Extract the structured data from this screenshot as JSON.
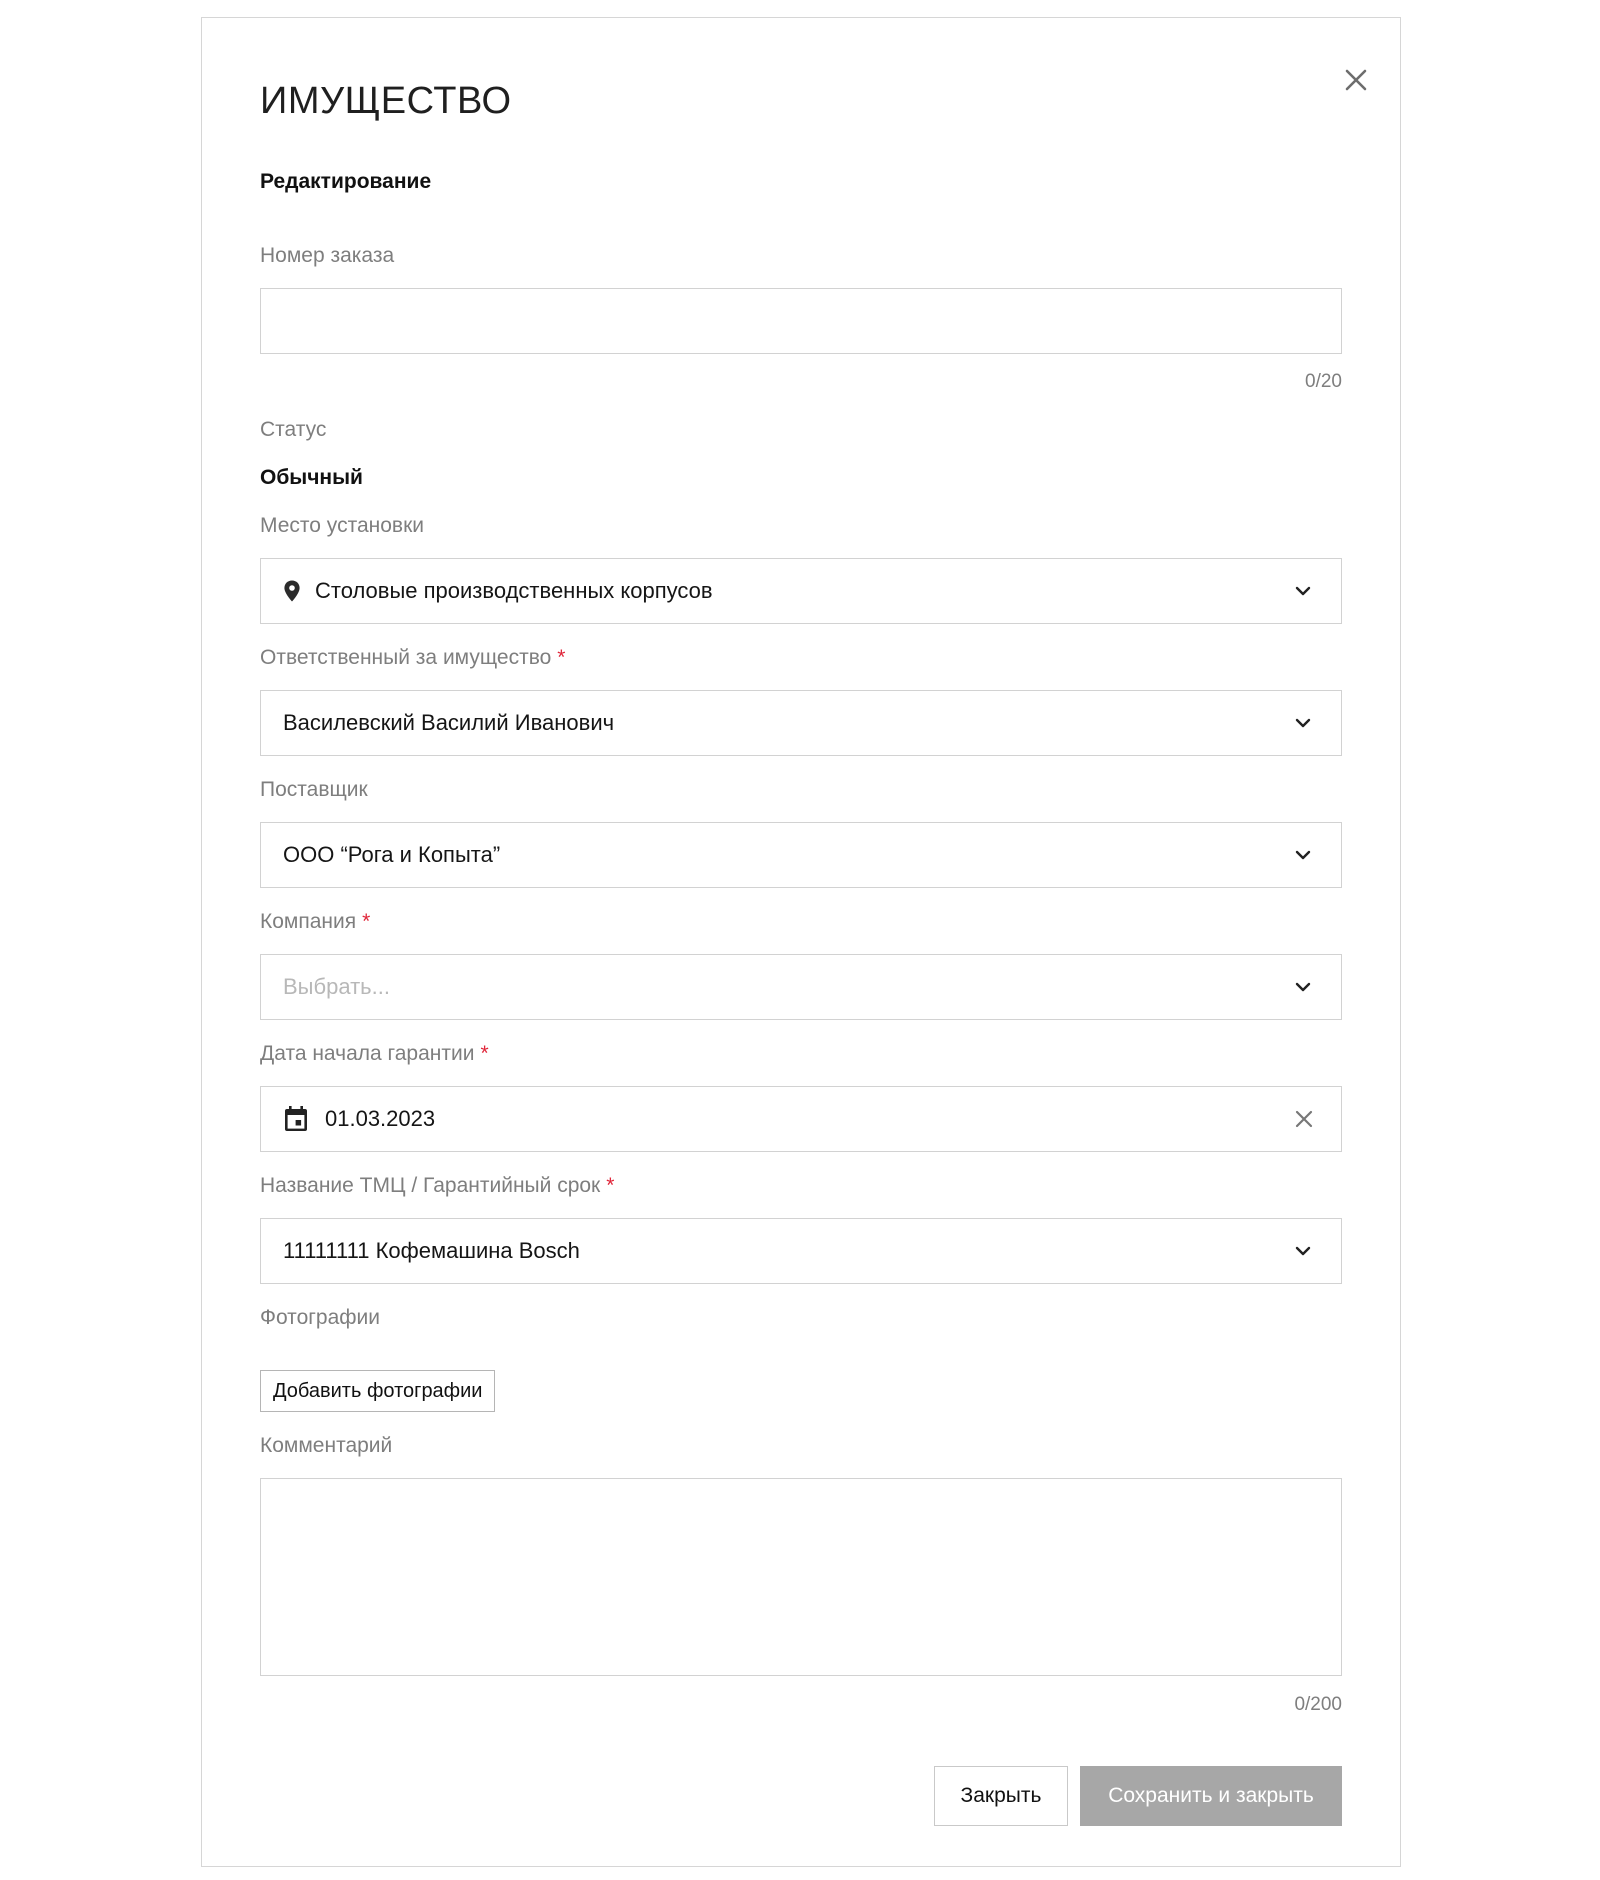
{
  "modal": {
    "title": "ИМУЩЕСТВО",
    "subtitle": "Редактирование"
  },
  "order_number": {
    "label": "Номер заказа",
    "value": "",
    "counter": "0/20"
  },
  "status": {
    "label": "Статус",
    "value": "Обычный"
  },
  "location": {
    "label": "Место установки",
    "value": "Столовые производственных корпусов",
    "icon": "location-pin-icon"
  },
  "responsible": {
    "label": "Ответственный за имущество",
    "required_mark": "*",
    "value": "Василевский Василий Иванович"
  },
  "supplier": {
    "label": "Поставщик",
    "value": "ООО “Рога и Копыта”"
  },
  "company": {
    "label": "Компания",
    "required_mark": "*",
    "placeholder": "Выбрать..."
  },
  "warranty_start": {
    "label": "Дата начала гарантии",
    "required_mark": "*",
    "value": "01.03.2023",
    "icon": "calendar-icon"
  },
  "item_name": {
    "label": "Название ТМЦ / Гарантийный срок",
    "required_mark": "*",
    "value": "11111111 Кофемашина Bosch"
  },
  "photos": {
    "label": "Фотографии",
    "button_label": "Добавить фотографии"
  },
  "comment": {
    "label": "Комментарий",
    "value": "",
    "counter": "0/200"
  },
  "footer": {
    "close_label": "Закрыть",
    "save_label": "Сохранить и закрыть"
  },
  "colors": {
    "required": "#e0263a",
    "label_gray": "#7e7e7e",
    "border": "#d2d2d2",
    "disabled_button": "#a7a7a7"
  }
}
